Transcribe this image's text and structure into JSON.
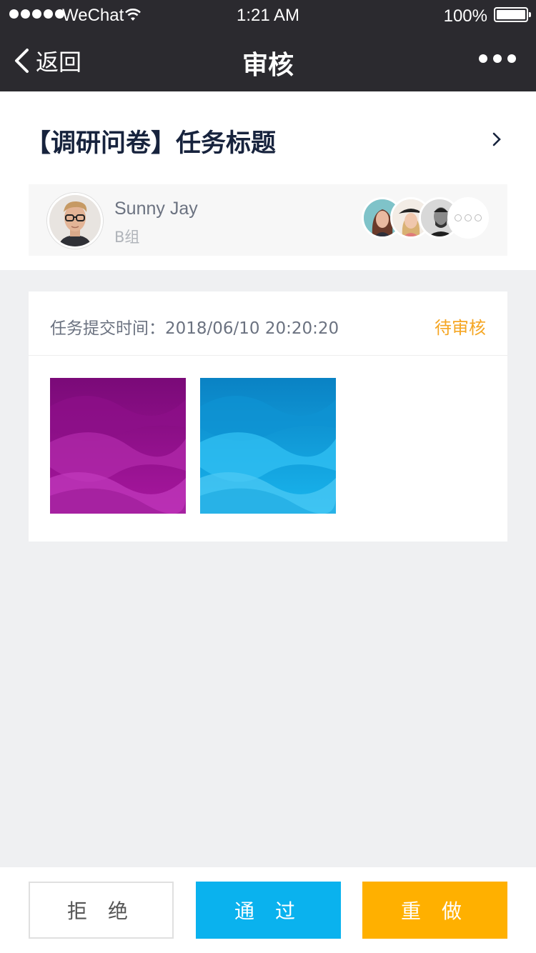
{
  "status_bar": {
    "carrier": "WeChat",
    "time": "1:21 AM",
    "battery": "100%"
  },
  "nav": {
    "back_label": "返回",
    "title": "审核"
  },
  "task": {
    "title": "【调研问卷】任务标题"
  },
  "submitter": {
    "name": "Sunny Jay",
    "group": "B组"
  },
  "submission": {
    "label": "任务提交时间：",
    "time": "2018/06/10 20:20:20",
    "status": "待审核",
    "status_color": "#f5a623"
  },
  "actions": {
    "reject": "拒 绝",
    "pass": "通 过",
    "redo": "重 做"
  },
  "colors": {
    "header_bg": "#2b2a2f",
    "pass": "#0ab2ee",
    "redo": "#ffb000"
  }
}
